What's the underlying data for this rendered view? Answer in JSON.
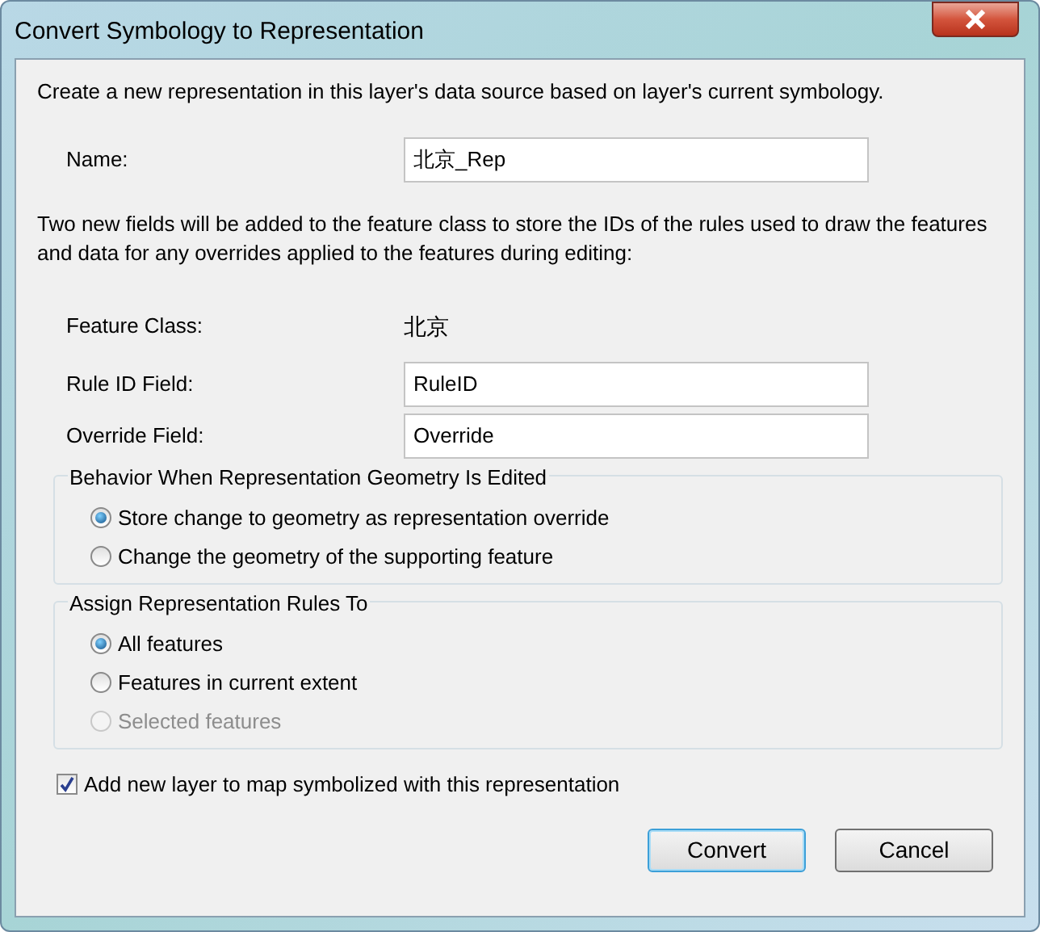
{
  "window": {
    "title": "Convert Symbology to Representation"
  },
  "intro": "Create a new representation in this layer's data source based on layer's current symbology.",
  "name_field": {
    "label": "Name:",
    "value": "北京_Rep"
  },
  "note": "Two new fields will be added to the feature class to store the IDs of the rules used to draw the features and data for any overrides applied to the features during editing:",
  "feature_class": {
    "label": "Feature Class:",
    "value": "北京"
  },
  "fields": [
    {
      "label": "Rule ID Field:",
      "value": "RuleID"
    },
    {
      "label": "Override Field:",
      "value": "Override"
    }
  ],
  "groups": [
    {
      "title": "Behavior When Representation Geometry Is Edited",
      "options": [
        {
          "label": "Store change to geometry as representation override",
          "selected": true,
          "disabled": false
        },
        {
          "label": "Change the geometry of the supporting feature",
          "selected": false,
          "disabled": false
        }
      ]
    },
    {
      "title": "Assign Representation Rules To",
      "options": [
        {
          "label": "All features",
          "selected": true,
          "disabled": false
        },
        {
          "label": "Features in current extent",
          "selected": false,
          "disabled": false
        },
        {
          "label": "Selected features",
          "selected": false,
          "disabled": true
        }
      ]
    }
  ],
  "add_layer": {
    "label": "Add new layer to map symbolized with this representation",
    "checked": true
  },
  "buttons": [
    {
      "label": "Convert",
      "default": true
    },
    {
      "label": "Cancel",
      "default": false
    }
  ]
}
